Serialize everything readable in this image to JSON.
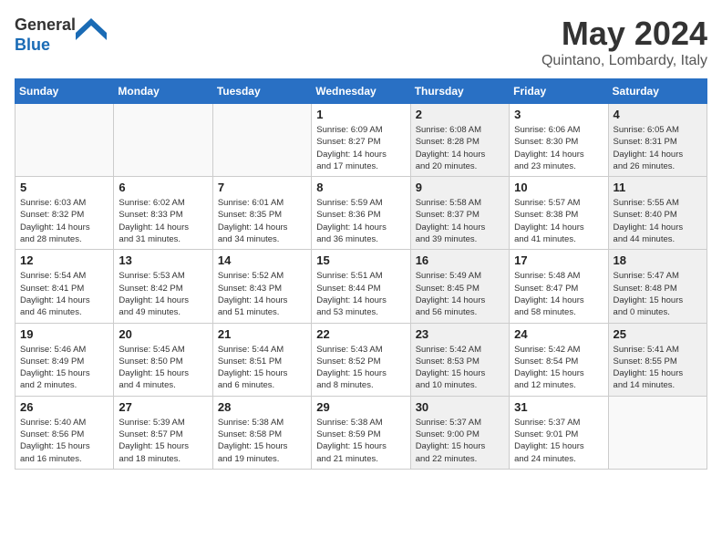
{
  "header": {
    "logo_line1": "General",
    "logo_line2": "Blue",
    "month_year": "May 2024",
    "location": "Quintano, Lombardy, Italy"
  },
  "weekdays": [
    "Sunday",
    "Monday",
    "Tuesday",
    "Wednesday",
    "Thursday",
    "Friday",
    "Saturday"
  ],
  "weeks": [
    [
      {
        "day": "",
        "info": "",
        "shaded": false,
        "empty": true
      },
      {
        "day": "",
        "info": "",
        "shaded": false,
        "empty": true
      },
      {
        "day": "",
        "info": "",
        "shaded": false,
        "empty": true
      },
      {
        "day": "1",
        "info": "Sunrise: 6:09 AM\nSunset: 8:27 PM\nDaylight: 14 hours\nand 17 minutes.",
        "shaded": false,
        "empty": false
      },
      {
        "day": "2",
        "info": "Sunrise: 6:08 AM\nSunset: 8:28 PM\nDaylight: 14 hours\nand 20 minutes.",
        "shaded": true,
        "empty": false
      },
      {
        "day": "3",
        "info": "Sunrise: 6:06 AM\nSunset: 8:30 PM\nDaylight: 14 hours\nand 23 minutes.",
        "shaded": false,
        "empty": false
      },
      {
        "day": "4",
        "info": "Sunrise: 6:05 AM\nSunset: 8:31 PM\nDaylight: 14 hours\nand 26 minutes.",
        "shaded": true,
        "empty": false
      }
    ],
    [
      {
        "day": "5",
        "info": "Sunrise: 6:03 AM\nSunset: 8:32 PM\nDaylight: 14 hours\nand 28 minutes.",
        "shaded": false,
        "empty": false
      },
      {
        "day": "6",
        "info": "Sunrise: 6:02 AM\nSunset: 8:33 PM\nDaylight: 14 hours\nand 31 minutes.",
        "shaded": false,
        "empty": false
      },
      {
        "day": "7",
        "info": "Sunrise: 6:01 AM\nSunset: 8:35 PM\nDaylight: 14 hours\nand 34 minutes.",
        "shaded": false,
        "empty": false
      },
      {
        "day": "8",
        "info": "Sunrise: 5:59 AM\nSunset: 8:36 PM\nDaylight: 14 hours\nand 36 minutes.",
        "shaded": false,
        "empty": false
      },
      {
        "day": "9",
        "info": "Sunrise: 5:58 AM\nSunset: 8:37 PM\nDaylight: 14 hours\nand 39 minutes.",
        "shaded": true,
        "empty": false
      },
      {
        "day": "10",
        "info": "Sunrise: 5:57 AM\nSunset: 8:38 PM\nDaylight: 14 hours\nand 41 minutes.",
        "shaded": false,
        "empty": false
      },
      {
        "day": "11",
        "info": "Sunrise: 5:55 AM\nSunset: 8:40 PM\nDaylight: 14 hours\nand 44 minutes.",
        "shaded": true,
        "empty": false
      }
    ],
    [
      {
        "day": "12",
        "info": "Sunrise: 5:54 AM\nSunset: 8:41 PM\nDaylight: 14 hours\nand 46 minutes.",
        "shaded": false,
        "empty": false
      },
      {
        "day": "13",
        "info": "Sunrise: 5:53 AM\nSunset: 8:42 PM\nDaylight: 14 hours\nand 49 minutes.",
        "shaded": false,
        "empty": false
      },
      {
        "day": "14",
        "info": "Sunrise: 5:52 AM\nSunset: 8:43 PM\nDaylight: 14 hours\nand 51 minutes.",
        "shaded": false,
        "empty": false
      },
      {
        "day": "15",
        "info": "Sunrise: 5:51 AM\nSunset: 8:44 PM\nDaylight: 14 hours\nand 53 minutes.",
        "shaded": false,
        "empty": false
      },
      {
        "day": "16",
        "info": "Sunrise: 5:49 AM\nSunset: 8:45 PM\nDaylight: 14 hours\nand 56 minutes.",
        "shaded": true,
        "empty": false
      },
      {
        "day": "17",
        "info": "Sunrise: 5:48 AM\nSunset: 8:47 PM\nDaylight: 14 hours\nand 58 minutes.",
        "shaded": false,
        "empty": false
      },
      {
        "day": "18",
        "info": "Sunrise: 5:47 AM\nSunset: 8:48 PM\nDaylight: 15 hours\nand 0 minutes.",
        "shaded": true,
        "empty": false
      }
    ],
    [
      {
        "day": "19",
        "info": "Sunrise: 5:46 AM\nSunset: 8:49 PM\nDaylight: 15 hours\nand 2 minutes.",
        "shaded": false,
        "empty": false
      },
      {
        "day": "20",
        "info": "Sunrise: 5:45 AM\nSunset: 8:50 PM\nDaylight: 15 hours\nand 4 minutes.",
        "shaded": false,
        "empty": false
      },
      {
        "day": "21",
        "info": "Sunrise: 5:44 AM\nSunset: 8:51 PM\nDaylight: 15 hours\nand 6 minutes.",
        "shaded": false,
        "empty": false
      },
      {
        "day": "22",
        "info": "Sunrise: 5:43 AM\nSunset: 8:52 PM\nDaylight: 15 hours\nand 8 minutes.",
        "shaded": false,
        "empty": false
      },
      {
        "day": "23",
        "info": "Sunrise: 5:42 AM\nSunset: 8:53 PM\nDaylight: 15 hours\nand 10 minutes.",
        "shaded": true,
        "empty": false
      },
      {
        "day": "24",
        "info": "Sunrise: 5:42 AM\nSunset: 8:54 PM\nDaylight: 15 hours\nand 12 minutes.",
        "shaded": false,
        "empty": false
      },
      {
        "day": "25",
        "info": "Sunrise: 5:41 AM\nSunset: 8:55 PM\nDaylight: 15 hours\nand 14 minutes.",
        "shaded": true,
        "empty": false
      }
    ],
    [
      {
        "day": "26",
        "info": "Sunrise: 5:40 AM\nSunset: 8:56 PM\nDaylight: 15 hours\nand 16 minutes.",
        "shaded": false,
        "empty": false
      },
      {
        "day": "27",
        "info": "Sunrise: 5:39 AM\nSunset: 8:57 PM\nDaylight: 15 hours\nand 18 minutes.",
        "shaded": false,
        "empty": false
      },
      {
        "day": "28",
        "info": "Sunrise: 5:38 AM\nSunset: 8:58 PM\nDaylight: 15 hours\nand 19 minutes.",
        "shaded": false,
        "empty": false
      },
      {
        "day": "29",
        "info": "Sunrise: 5:38 AM\nSunset: 8:59 PM\nDaylight: 15 hours\nand 21 minutes.",
        "shaded": false,
        "empty": false
      },
      {
        "day": "30",
        "info": "Sunrise: 5:37 AM\nSunset: 9:00 PM\nDaylight: 15 hours\nand 22 minutes.",
        "shaded": true,
        "empty": false
      },
      {
        "day": "31",
        "info": "Sunrise: 5:37 AM\nSunset: 9:01 PM\nDaylight: 15 hours\nand 24 minutes.",
        "shaded": false,
        "empty": false
      },
      {
        "day": "",
        "info": "",
        "shaded": true,
        "empty": true
      }
    ]
  ]
}
